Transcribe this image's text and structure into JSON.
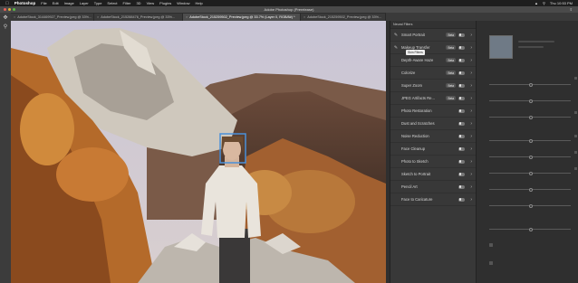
{
  "menubar": {
    "app": "Photoshop",
    "menus": [
      "File",
      "Edit",
      "Image",
      "Layer",
      "Type",
      "Select",
      "Filter",
      "3D",
      "View",
      "Plugins",
      "Window",
      "Help"
    ],
    "clock": "Thu 10:53 PM"
  },
  "window": {
    "title": "Adobe Photoshop (Prerelease)"
  },
  "tabs": [
    {
      "label": "AdobeStock_314469927_Preview.jpeg @ 33%...",
      "active": false
    },
    {
      "label": "AdobeStock_215288476_Preview.jpeg @ 33%...",
      "active": false
    },
    {
      "label": "AdobeStock_215259502_Preview.jpeg @ 33.7% (Layer 0, RGB/8#) *",
      "active": true
    },
    {
      "label": "AdobeStock_215259502_Preview.jpeg @ 33%...",
      "active": false
    }
  ],
  "filters_panel": {
    "header": "Neural Filters",
    "tooltip": "Skin Filters",
    "items": [
      {
        "name": "Smart Portrait",
        "badge": "Beta",
        "has_toggle": true
      },
      {
        "name": "Makeup Transfer",
        "badge": "Beta",
        "has_toggle": true
      },
      {
        "name": "Depth-Aware Haze",
        "badge": "Beta",
        "has_toggle": true
      },
      {
        "name": "Colorize",
        "badge": "Beta",
        "has_toggle": true
      },
      {
        "name": "Super Zoom",
        "badge": "Beta",
        "has_toggle": true
      },
      {
        "name": "JPEG Artifacts Re...",
        "badge": "Beta",
        "has_toggle": true
      },
      {
        "name": "Photo Restoration",
        "badge": "",
        "has_toggle": true
      },
      {
        "name": "Dust and Scratches",
        "badge": "",
        "has_toggle": true
      },
      {
        "name": "Noise Reduction",
        "badge": "",
        "has_toggle": true
      },
      {
        "name": "Face Cleanup",
        "badge": "",
        "has_toggle": true
      },
      {
        "name": "Photo to Sketch",
        "badge": "",
        "has_toggle": true
      },
      {
        "name": "Sketch to Portrait",
        "badge": "",
        "has_toggle": true
      },
      {
        "name": "Pencil Art",
        "badge": "",
        "has_toggle": true
      },
      {
        "name": "Face to Caricature",
        "badge": "",
        "has_toggle": true
      }
    ]
  },
  "icons": {
    "apple": "apple-icon",
    "move_tool": "move-tool-icon",
    "zoom_tool": "zoom-tool-icon",
    "brush": "brush-icon",
    "chevron": "chevron-right-icon",
    "wifi": "wifi-icon",
    "search": "search-icon"
  },
  "colors": {
    "accent": "#4a90d9",
    "panel": "#383838",
    "dark_panel": "#2f2f2f"
  }
}
